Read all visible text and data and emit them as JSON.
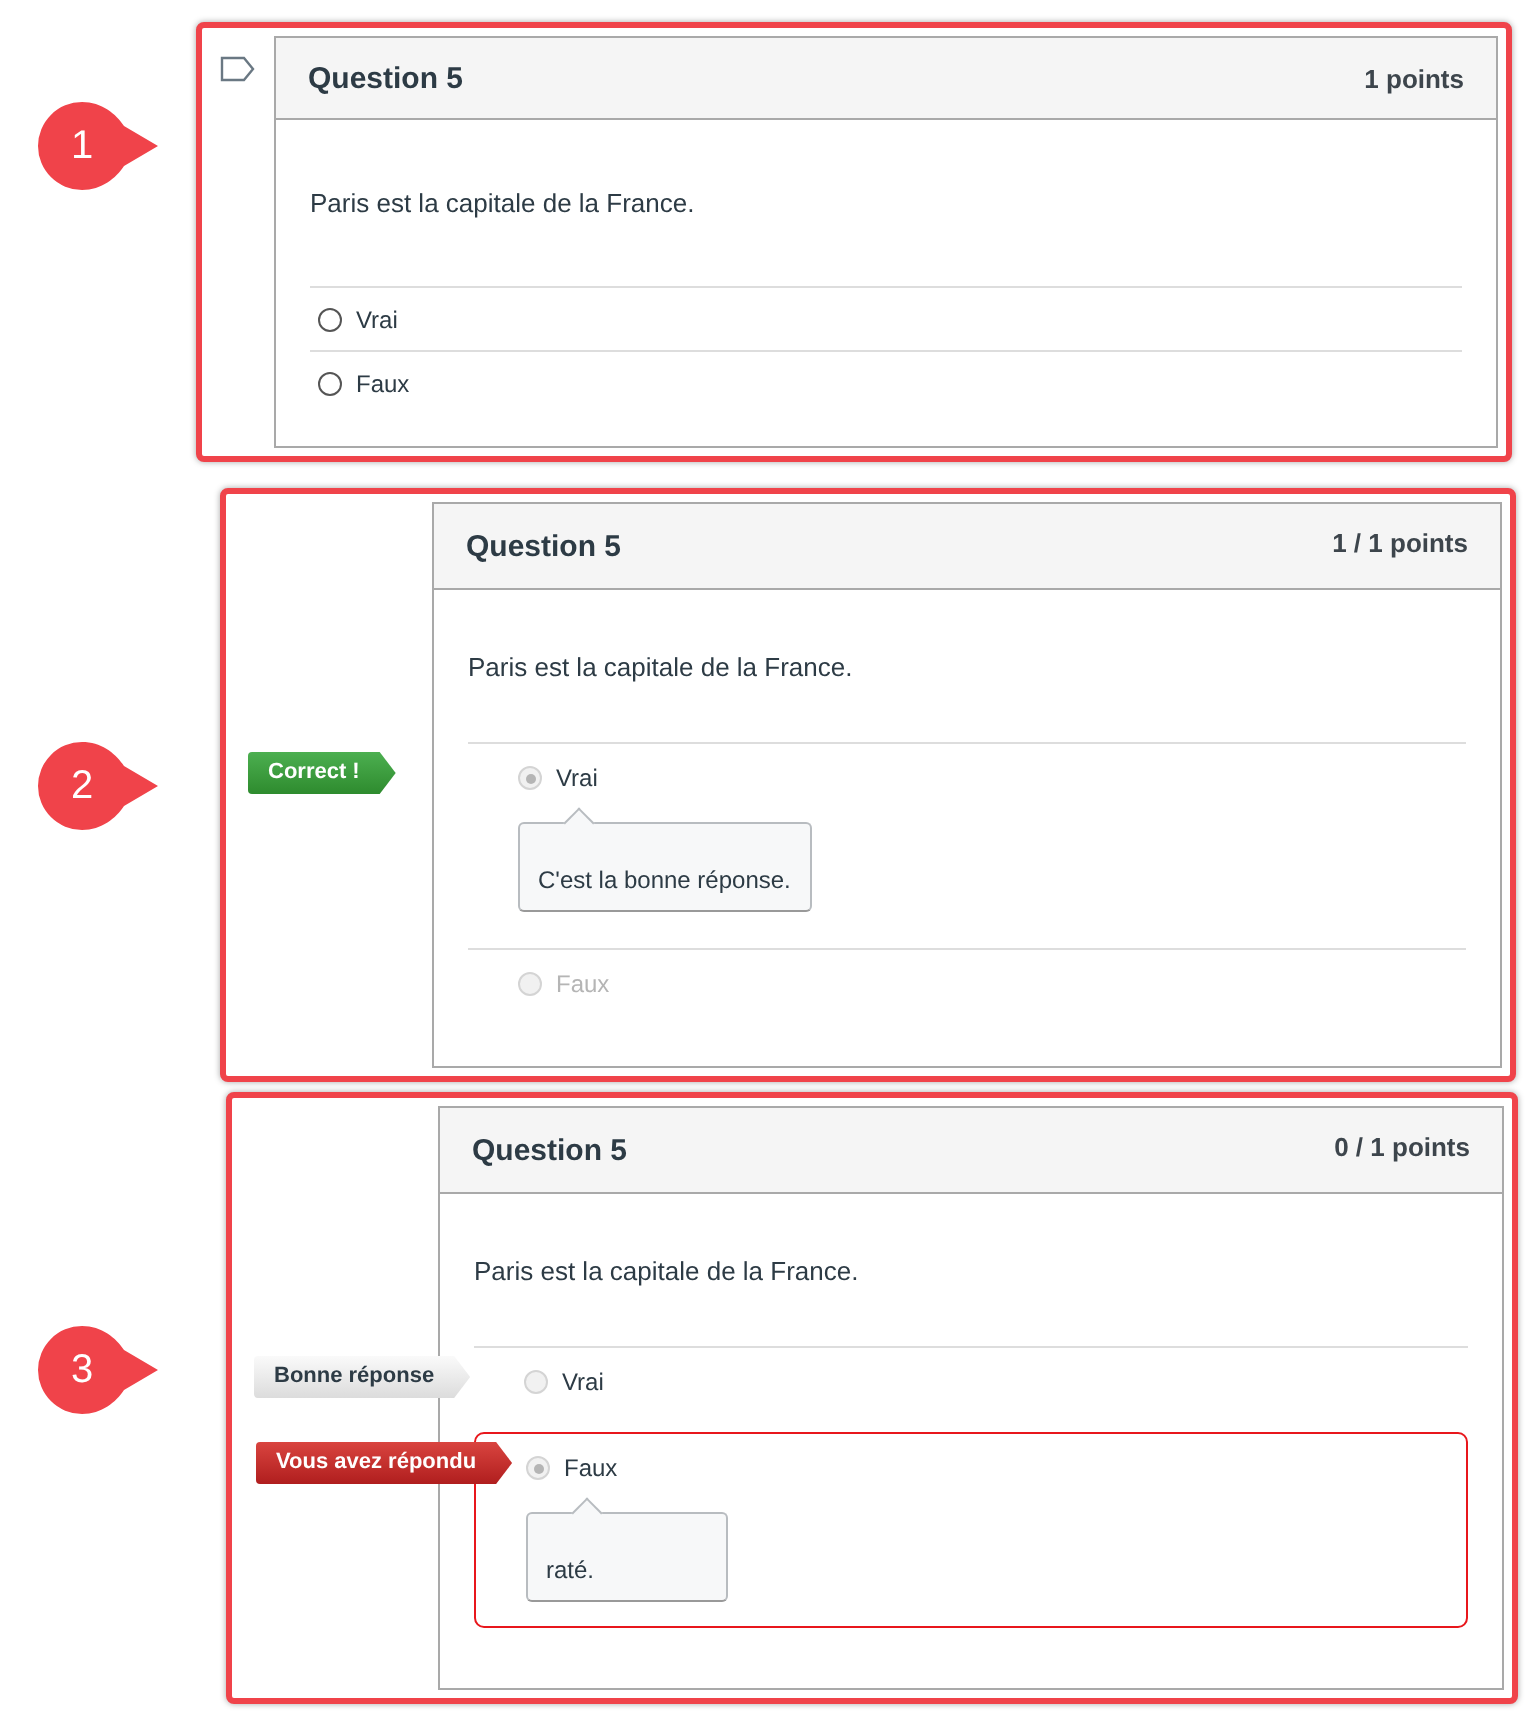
{
  "panels": [
    {
      "marker": "1",
      "flag": true,
      "locked": false,
      "title": "Question 5",
      "points": "1 points",
      "text": "Paris est la capitale de la France.",
      "answers": [
        {
          "label": "Vrai",
          "selected": false,
          "dimmed": false,
          "wrong": false
        },
        {
          "label": "Faux",
          "selected": false,
          "dimmed": false,
          "wrong": false
        }
      ]
    },
    {
      "marker": "2",
      "flag": false,
      "locked": true,
      "title": "Question 5",
      "points": "1 / 1 points",
      "text": "Paris est la capitale de la France.",
      "answers": [
        {
          "label": "Vrai",
          "selected": true,
          "dimmed": false,
          "wrong": false,
          "tag": {
            "kind": "correct",
            "text": "Correct !"
          },
          "comment": "C'est la bonne réponse."
        },
        {
          "label": "Faux",
          "selected": false,
          "dimmed": true,
          "wrong": false
        }
      ]
    },
    {
      "marker": "3",
      "flag": false,
      "locked": true,
      "title": "Question 5",
      "points": "0 / 1 points",
      "text": "Paris est la capitale de la France.",
      "answers": [
        {
          "label": "Vrai",
          "selected": false,
          "dimmed": false,
          "wrong": false,
          "tag": {
            "kind": "right-answer",
            "text": "Bonne réponse"
          }
        },
        {
          "label": "Faux",
          "selected": true,
          "dimmed": false,
          "wrong": true,
          "tag": {
            "kind": "you-answered",
            "text": "Vous avez répondu"
          },
          "comment": "raté."
        }
      ]
    }
  ]
}
